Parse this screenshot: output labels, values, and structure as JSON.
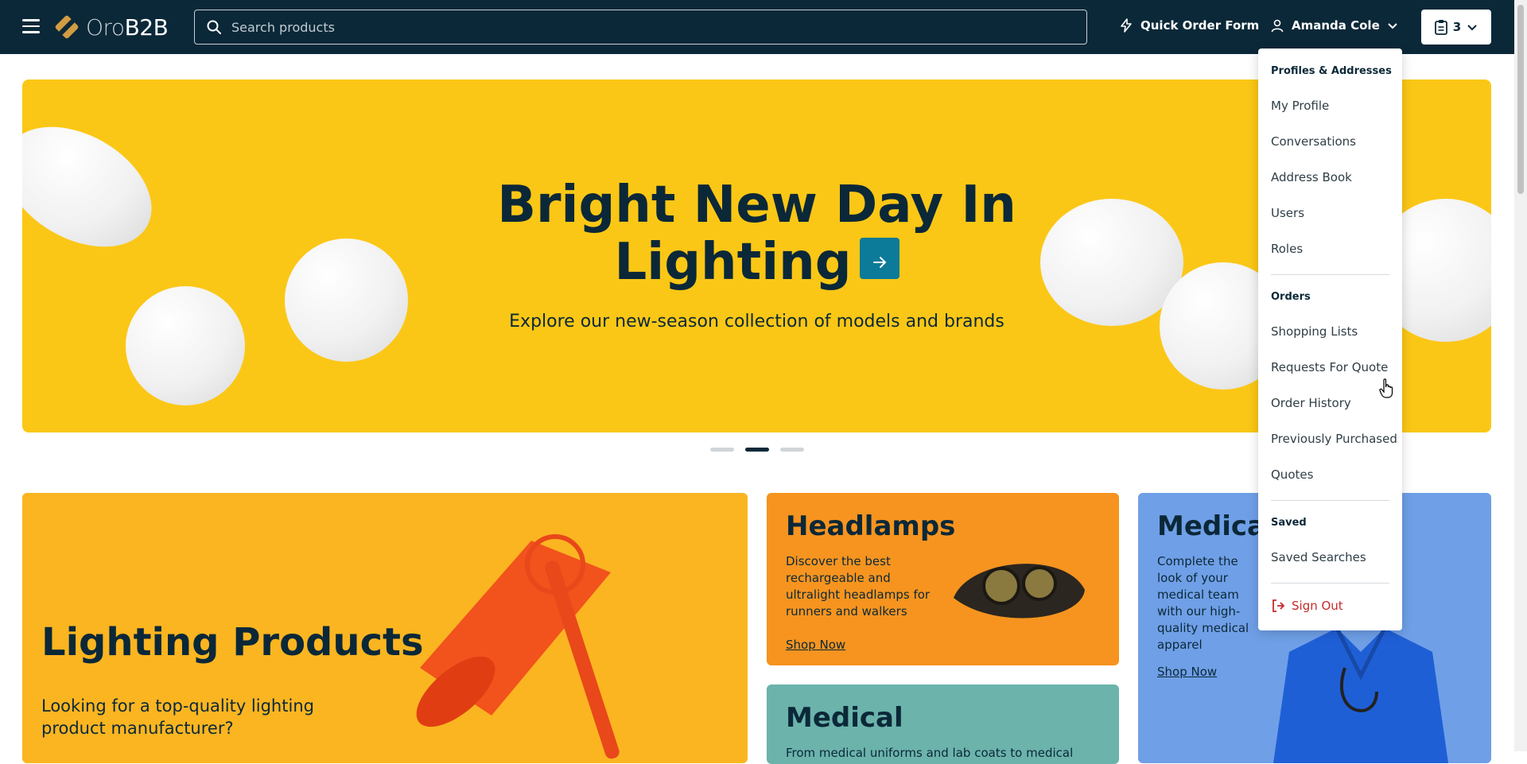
{
  "header": {
    "logo_text_light": "Oro",
    "logo_text_bold": "B2B",
    "search_placeholder": "Search products",
    "quick_order_label": "Quick Order Form",
    "user_name": "Amanda Cole",
    "cart_count": "3"
  },
  "hero": {
    "title_line1": "Bright New Day In",
    "title_line2": "Lighting",
    "subtitle": "Explore our new-season collection of models and brands",
    "slide_count": 3,
    "active_slide": 2
  },
  "tiles": {
    "lighting": {
      "title": "Lighting Products",
      "text": "Looking for a top-quality lighting product manufacturer?"
    },
    "headlamps": {
      "title": "Headlamps",
      "text": "Discover the best rechargeable and ultralight headlamps for runners and walkers",
      "link": "Shop Now"
    },
    "medical_small": {
      "title": "Medical",
      "text": "From medical uniforms and lab coats to medical"
    },
    "medical_big": {
      "title": "Medical",
      "text": "Complete the look of your medical team with our high-quality medical apparel",
      "link": "Shop Now"
    }
  },
  "dropdown": {
    "sections": {
      "profiles": "Profiles & Addresses",
      "orders": "Orders",
      "saved": "Saved"
    },
    "items": {
      "my_profile": "My Profile",
      "conversations": "Conversations",
      "address_book": "Address Book",
      "users": "Users",
      "roles": "Roles",
      "shopping_lists": "Shopping Lists",
      "requests_for_quote": "Requests For Quote",
      "order_history": "Order History",
      "previously_purchased": "Previously Purchased",
      "quotes": "Quotes",
      "saved_searches": "Saved Searches",
      "sign_out": "Sign Out"
    }
  },
  "colors": {
    "brand_dark": "#0b2838",
    "hero_yellow": "#fbc716",
    "accent_teal": "#0c7a99",
    "sign_out_red": "#c92a2a"
  }
}
